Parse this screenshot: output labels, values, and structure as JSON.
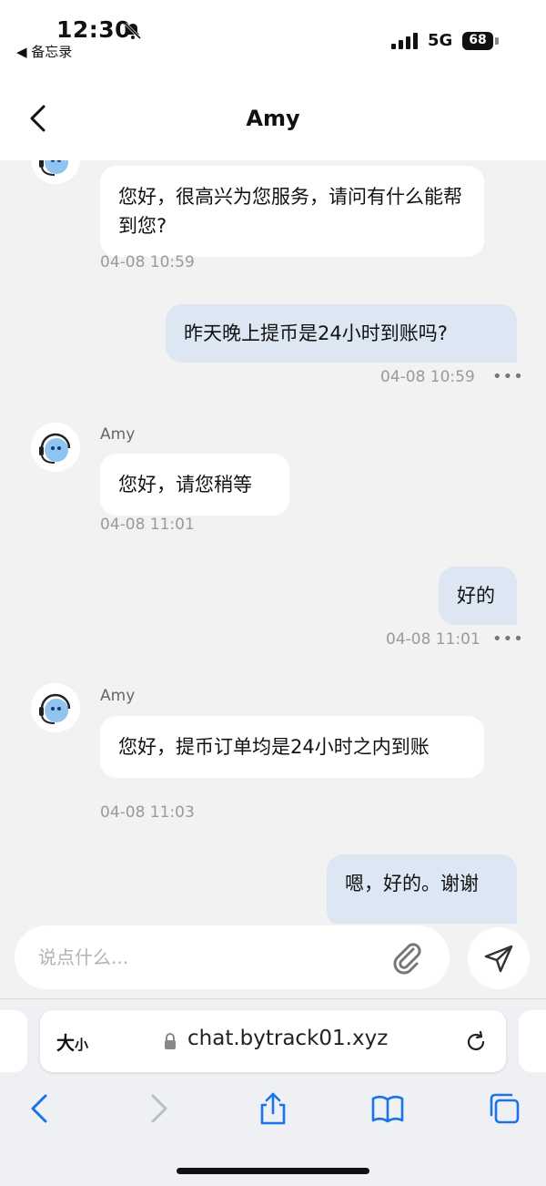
{
  "status": {
    "time": "12:30",
    "back_app": "◀ 备忘录",
    "network": "5G",
    "battery": "68"
  },
  "header": {
    "title": "Amy"
  },
  "messages": [
    {
      "text": "您好，很高兴为您服务，请问有什么能帮到您?",
      "time": "04-08 10:59"
    },
    {
      "text": "昨天晚上提币是24小时到账吗?",
      "time": "04-08 10:59",
      "more": "•••"
    },
    {
      "name": "Amy",
      "text": "您好，请您稍等",
      "time": "04-08 11:01"
    },
    {
      "text": "好的",
      "time": "04-08 11:01",
      "more": "•••"
    },
    {
      "name": "Amy",
      "text": "您好，提币订单均是24小时之内到账",
      "time": "04-08 11:03"
    },
    {
      "text": "嗯，好的。谢谢"
    }
  ],
  "composer": {
    "placeholder": "说点什么..."
  },
  "safari": {
    "aa_big": "大",
    "aa_small": "小",
    "url": "chat.bytrack01.xyz"
  }
}
